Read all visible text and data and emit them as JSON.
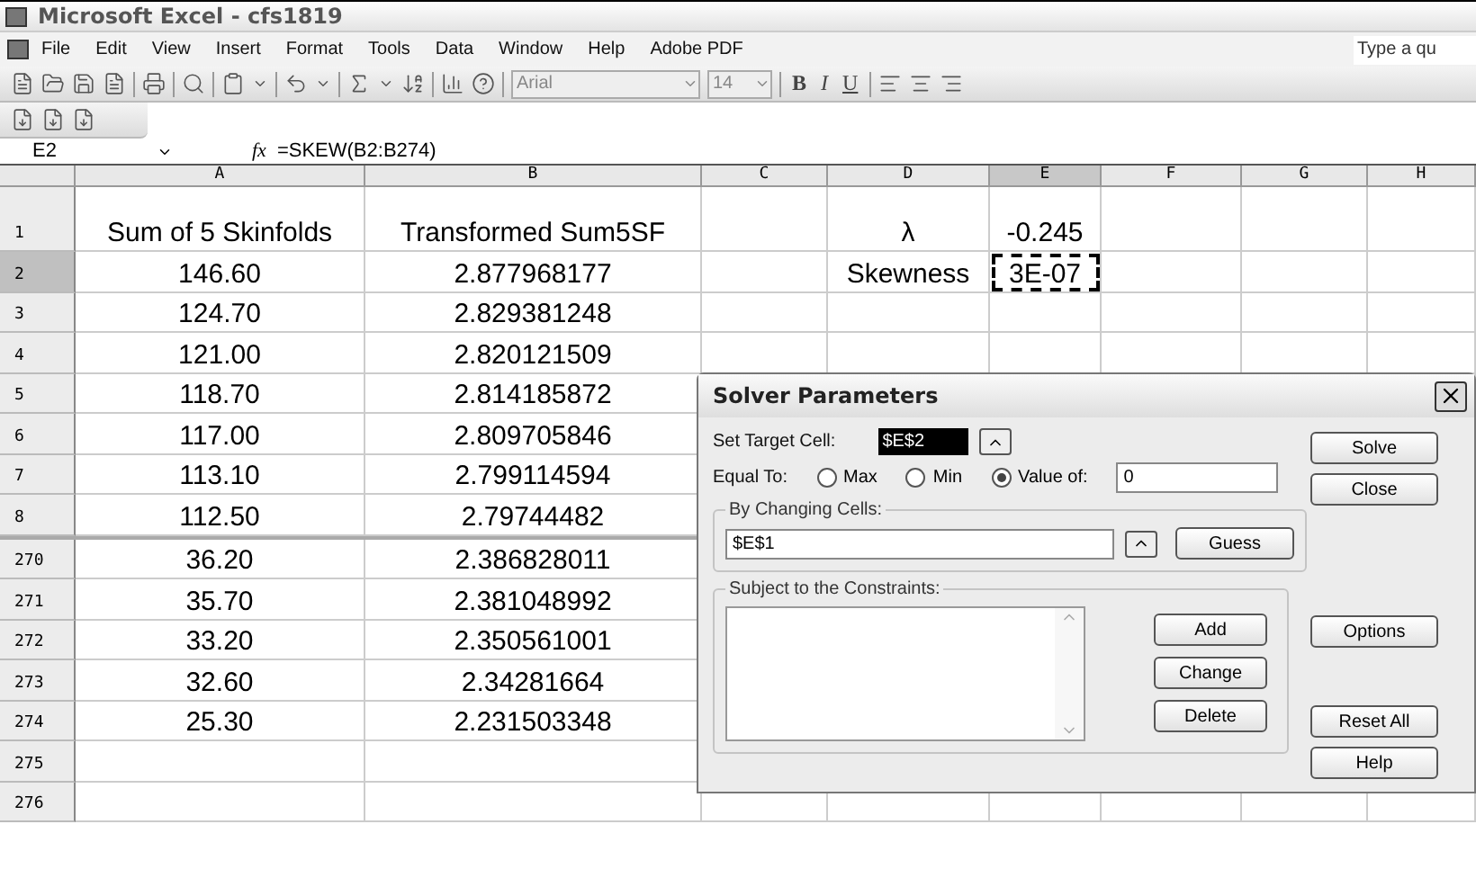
{
  "window": {
    "title": "Microsoft Excel - cfs1819"
  },
  "menu": [
    "File",
    "Edit",
    "View",
    "Insert",
    "Format",
    "Tools",
    "Data",
    "Window",
    "Help",
    "Adobe PDF"
  ],
  "help_search": {
    "placeholder": "Type a qu"
  },
  "toolbar": {
    "font": "Arial",
    "size": "14",
    "format_buttons": [
      "B",
      "I",
      "U"
    ]
  },
  "formula_bar": {
    "name_box": "E2",
    "fx_label": "fx",
    "formula": "=SKEW(B2:B274)"
  },
  "sheet": {
    "columns": [
      {
        "label": "A",
        "selected": false
      },
      {
        "label": "B",
        "selected": false
      },
      {
        "label": "C",
        "selected": false
      },
      {
        "label": "D",
        "selected": false
      },
      {
        "label": "E",
        "selected": true
      },
      {
        "label": "F",
        "selected": false
      },
      {
        "label": "G",
        "selected": false
      },
      {
        "label": "H",
        "selected": false
      }
    ],
    "panes": [
      {
        "rows": [
          {
            "header": "1",
            "selected": false,
            "cells": [
              "Sum of 5 Skinfolds",
              "Transformed Sum5SF",
              "",
              "λ",
              "-0.245"
            ]
          },
          {
            "header": "2",
            "selected": true,
            "cells": [
              "146.60",
              "2.877968177",
              "",
              "Skewness",
              "3E-07"
            ]
          },
          {
            "header": "3",
            "selected": false,
            "cells": [
              "124.70",
              "2.829381248"
            ]
          },
          {
            "header": "4",
            "selected": false,
            "cells": [
              "121.00",
              "2.820121509"
            ]
          },
          {
            "header": "5",
            "selected": false,
            "cells": [
              "118.70",
              "2.814185872"
            ]
          },
          {
            "header": "6",
            "selected": false,
            "cells": [
              "117.00",
              "2.809705846"
            ]
          },
          {
            "header": "7",
            "selected": false,
            "cells": [
              "113.10",
              "2.799114594"
            ]
          },
          {
            "header": "8",
            "selected": false,
            "cells": [
              "112.50",
              "2.79744482"
            ]
          }
        ]
      },
      {
        "rows": [
          {
            "header": "270",
            "selected": false,
            "cells": [
              "36.20",
              "2.386828011"
            ]
          },
          {
            "header": "271",
            "selected": false,
            "cells": [
              "35.70",
              "2.381048992"
            ]
          },
          {
            "header": "272",
            "selected": false,
            "cells": [
              "33.20",
              "2.350561001"
            ]
          },
          {
            "header": "273",
            "selected": false,
            "cells": [
              "32.60",
              "2.34281664"
            ]
          },
          {
            "header": "274",
            "selected": false,
            "cells": [
              "25.30",
              "2.231503348"
            ]
          },
          {
            "header": "275",
            "selected": false,
            "cells": []
          },
          {
            "header": "276",
            "selected": false,
            "cells": []
          }
        ]
      }
    ]
  },
  "dialog": {
    "title": "Solver Parameters",
    "target_label": "Set Target Cell:",
    "target_value": "$E$2",
    "equal_label": "Equal To:",
    "options": [
      {
        "label": "Max",
        "selected": false
      },
      {
        "label": "Min",
        "selected": false
      },
      {
        "label": "Value of:",
        "selected": true
      }
    ],
    "value": "0",
    "changing_label": "By Changing Cells:",
    "changing_value": "$E$1",
    "guess": "Guess",
    "constraints_label": "Subject to the Constraints:",
    "constraint_buttons": [
      "Add",
      "Change",
      "Delete"
    ],
    "side_buttons": [
      "Solve",
      "Close",
      "Options",
      "Reset All",
      "Help"
    ]
  }
}
